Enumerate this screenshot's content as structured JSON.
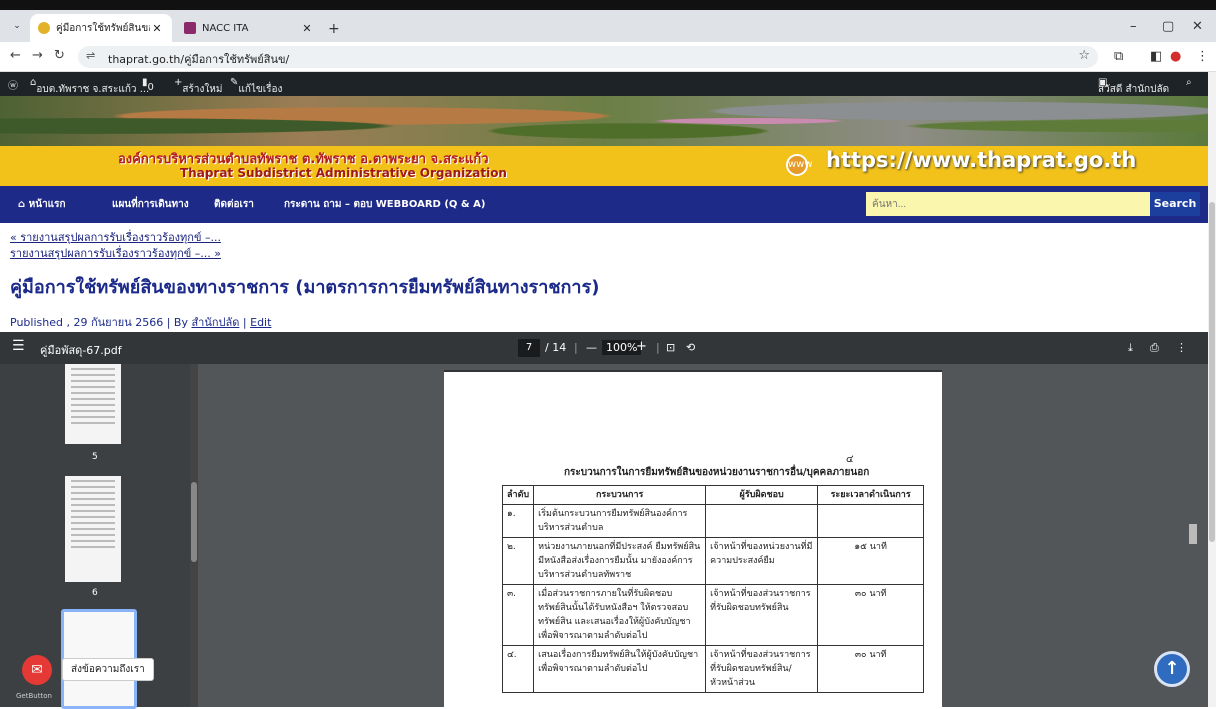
{
  "browser": {
    "tabs": [
      {
        "title": "คู่มือการใช้ทรัพย์สินของทางราชการ |",
        "active": true
      },
      {
        "title": "NACC ITA",
        "active": false
      }
    ],
    "url": "thaprat.go.th/คู่มือการใช้ทรัพย์สินข/"
  },
  "wpbar": {
    "site": "อบต.ทัพราช จ.สระแก้ว ...",
    "comments": "0",
    "new": "สร้างใหม่",
    "edit": "แก้ไขเรื่อง",
    "user": "สวัสดี สำนักปลัด"
  },
  "banner": {
    "org_th": "องค์การบริหารส่วนตำบลทัพราช ต.ทัพราช อ.ตาพระยา จ.สระแก้ว",
    "org_en": "Thaprat Subdistrict Administrative Organization",
    "url": "https://www.thaprat.go.th"
  },
  "nav": {
    "items": [
      "หน้าแรก",
      "แผนที่การเดินทาง",
      "ติดต่อเรา",
      "กระดาน ถาม – ตอบ WEBBOARD (Q & A)"
    ],
    "search_placeholder": "ค้นหา...",
    "search_label": "Search"
  },
  "content": {
    "prev_link": "« รายงานสรุปผลการรับเรื่องราวร้องทุกข์ –...",
    "next_link": "รายงานสรุปผลการรับเรื่องราวร้องทุกข์ –... »",
    "title": "คู่มือการใช้ทรัพย์สินของทางราชการ (มาตรการการยืมทรัพย์สินทางราชการ)",
    "meta_prefix": "Published , 29 กันยายน 2566 | By",
    "author": "สำนักปลัด",
    "sep": "|",
    "edit": "Edit"
  },
  "pdf": {
    "filename": "คู่มือพัสดุ-67.pdf",
    "page": "7",
    "total": "/ 14",
    "zoom": "100%",
    "thumb_labels": [
      "5",
      "6"
    ],
    "page_number": "๔",
    "doc_title": "กระบวนการในการยืมทรัพย์สินของหน่วยงานราชการอื่น/บุคคลภายนอก",
    "headers": [
      "ลำดับ",
      "กระบวนการ",
      "ผู้รับผิดชอบ",
      "ระยะเวลาดำเนินการ"
    ],
    "rows": [
      [
        "๑.",
        "เริ่มต้นกระบวนการยืมทรัพย์สินองค์การบริหารส่วนตำบล",
        "",
        ""
      ],
      [
        "๒.",
        "หน่วยงานภายนอกที่มีประสงค์ ยืมทรัพย์สิน มีหนังสือส่งเรื่องการยืมนั้น มายังองค์การบริหารส่วนตำบลทัพราช",
        "เจ้าหน้าที่ของหน่วยงานที่มีความประสงค์ยืม",
        "๑๕ นาที"
      ],
      [
        "๓.",
        "เมื่อส่วนราชการภายในที่รับผิดชอบทรัพย์สินนั้นได้รับหนังสือฯ ให้ตรวจสอบทรัพย์สิน และเสนอเรื่องให้ผู้บังคับบัญชา เพื่อพิจารณาตามลำดับต่อไป",
        "เจ้าหน้าที่ของส่วนราชการที่รับผิดชอบทรัพย์สิน",
        "๓๐ นาที"
      ],
      [
        "๔.",
        "เสนอเรื่องการยืมทรัพย์สินให้ผู้บังคับบัญชา เพื่อพิจารณาตามลำดับต่อไป",
        "เจ้าหน้าที่ของส่วนราชการที่รับผิดชอบทรัพย์สิน/หัวหน้าส่วน",
        "๓๐ นาที"
      ]
    ]
  },
  "widgets": {
    "chat_label": "ส่งข้อความถึงเรา",
    "getbutton": "GetButton"
  }
}
